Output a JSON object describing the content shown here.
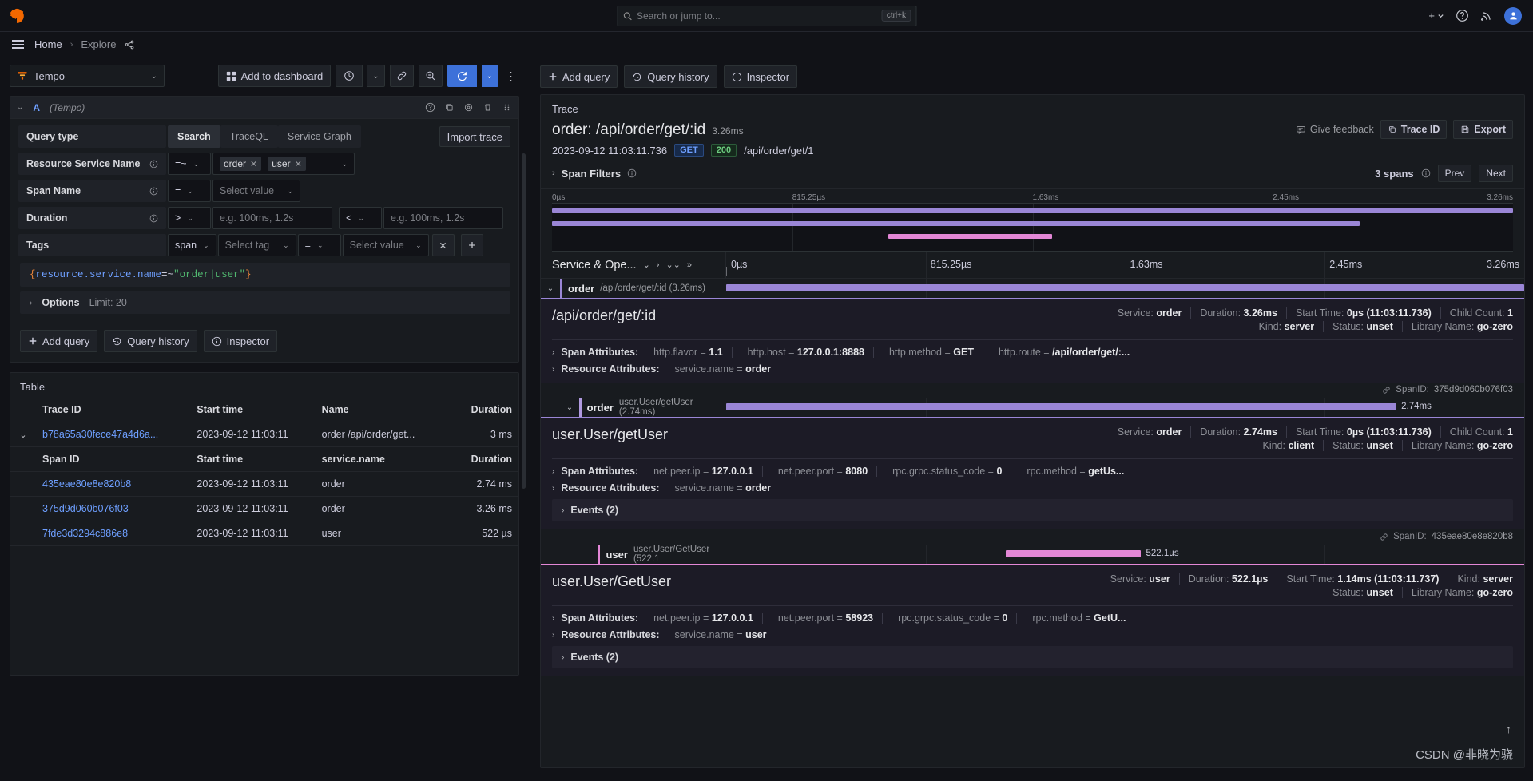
{
  "topbar": {
    "logo_icon": "grafana-logo-icon",
    "search": {
      "placeholder": "Search or jump to...",
      "value": "",
      "shortcut": "ctrl+k",
      "icon": "search-icon"
    },
    "plus_label": "+",
    "help_icon": "help-circle-icon",
    "news_icon": "rss-icon",
    "avatar_icon": "user-avatar-icon"
  },
  "breadcrumb": {
    "menu_icon": "hamburger-menu-icon",
    "home": "Home",
    "separator": "›",
    "current": "Explore",
    "share_icon": "share-icon"
  },
  "toolbar": {
    "datasource": "Tempo",
    "datasource_icon": "tempo-icon",
    "add_to_dashboard": "Add to dashboard",
    "time_picker_icon": "clock-icon",
    "time_chevron": "⌄",
    "link_icon": "link-icon",
    "zoom_out_icon": "zoom-out-icon",
    "refresh_icon": "refresh-icon",
    "refresh_chevron": "⌄",
    "kebab_icon": "more-vertical-icon"
  },
  "query_editor": {
    "collapse_icon": "chevron-down-icon",
    "ref_id": "A",
    "datasource_name": "(Tempo)",
    "actions": [
      "help-circle-icon",
      "copy-icon",
      "eye-icon",
      "trash-icon",
      "drag-handle-icon"
    ],
    "query_type_label": "Query type",
    "query_types": [
      "Search",
      "TraceQL",
      "Service Graph"
    ],
    "active_query_type": "Search",
    "import_trace": "Import trace",
    "fields": [
      {
        "label": "Resource Service Name",
        "info_icon": "info-icon",
        "operator": "=~",
        "values": [
          "order",
          "user"
        ],
        "value_placeholder": ""
      },
      {
        "label": "Span Name",
        "info_icon": "info-icon",
        "operator": "=",
        "value_placeholder": "Select value"
      },
      {
        "label": "Duration",
        "info_icon": "info-icon",
        "operator": ">",
        "min_placeholder": "e.g. 100ms, 1.2s",
        "operator2": "<",
        "max_placeholder": "e.g. 100ms, 1.2s"
      }
    ],
    "tags": {
      "label": "Tags",
      "scope": "span",
      "tag_placeholder": "Select tag",
      "operator": "=",
      "value_placeholder": "Select value",
      "clear_icon": "close-icon",
      "add_icon": "plus-icon"
    },
    "traceql": {
      "open_brace": "{",
      "key": "resource.service.name",
      "operator": "=~",
      "quote_open": "\"",
      "value_a": "order",
      "pipe": "|",
      "value_b": "user",
      "quote_close": "\"",
      "close_brace": "}"
    },
    "options": {
      "chevron": "›",
      "label": "Options",
      "limit": "Limit: 20"
    },
    "buttons": [
      {
        "label": "Add query",
        "icon": "plus-icon"
      },
      {
        "label": "Query history",
        "icon": "history-icon"
      },
      {
        "label": "Inspector",
        "icon": "info-icon"
      }
    ]
  },
  "results_table": {
    "title": "Table",
    "columns": [
      "Trace ID",
      "Start time",
      "Name",
      "Duration"
    ],
    "rows": [
      {
        "expander": "⌄",
        "trace_id": "b78a65a30fece47a4d6a...",
        "start_time": "2023-09-12 11:03:11",
        "name": "order /api/order/get...",
        "duration": "3 ms"
      }
    ],
    "sub_columns": [
      "Span ID",
      "Start time",
      "service.name",
      "Duration"
    ],
    "sub_rows": [
      {
        "span_id": "435eae80e8e820b8",
        "start_time": "2023-09-12 11:03:11",
        "service_name": "order",
        "duration": "2.74 ms"
      },
      {
        "span_id": "375d9d060b076f03",
        "start_time": "2023-09-12 11:03:11",
        "service_name": "order",
        "duration": "3.26 ms"
      },
      {
        "span_id": "7fde3d3294c886e8",
        "start_time": "2023-09-12 11:03:11",
        "service_name": "user",
        "duration": "522 µs"
      }
    ]
  },
  "right_toolbar": {
    "buttons": [
      {
        "label": "Add query",
        "icon": "plus-icon"
      },
      {
        "label": "Query history",
        "icon": "history-icon"
      },
      {
        "label": "Inspector",
        "icon": "info-icon"
      }
    ]
  },
  "trace": {
    "panel_label": "Trace",
    "title": "order: /api/order/get/:id",
    "duration": "3.26ms",
    "timestamp": "2023-09-12 11:03:11.736",
    "method": "GET",
    "status_code": "200",
    "route": "/api/order/get/1",
    "give_feedback": "Give feedback",
    "give_feedback_icon": "feedback-icon",
    "trace_id_button": "Trace ID",
    "trace_id_icon": "copy-icon",
    "export_button": "Export",
    "export_icon": "save-icon",
    "span_filters": {
      "chevron": "›",
      "label": "Span Filters",
      "info_icon": "info-icon",
      "count": "3 spans",
      "count_info_icon": "info-icon",
      "prev": "Prev",
      "next": "Next"
    },
    "minimap_ticks": [
      "0µs",
      "815.25µs",
      "1.63ms",
      "2.45ms",
      "3.26ms"
    ],
    "timeline_header": {
      "column_label": "Service & Ope...",
      "column_chevron": "⌄",
      "expand_one_icon": "chevron-right-icon",
      "expand_all_icon": "chevrons-down-icon",
      "collapse_all_icon": "chevrons-right-icon",
      "ticks": [
        "0µs",
        "815.25µs",
        "1.63ms",
        "2.45ms",
        "3.26ms"
      ]
    },
    "spans": [
      {
        "service": "order",
        "operation": "/api/order/get/:id (3.26ms)",
        "bar_start_pct": 0,
        "bar_width_pct": 100,
        "bar_color": "#9a86d6",
        "bar_label": "",
        "depth": 0,
        "expander": "⌄",
        "detail": {
          "op_name": "/api/order/get/:id",
          "meta_line1": [
            {
              "k": "Service:",
              "v": "order"
            },
            {
              "k": "Duration:",
              "v": "3.26ms"
            },
            {
              "k": "Start Time:",
              "v": "0µs (11:03:11.736)"
            },
            {
              "k": "Child Count:",
              "v": "1"
            }
          ],
          "meta_line2": [
            {
              "k": "Kind:",
              "v": "server"
            },
            {
              "k": "Status:",
              "v": "unset"
            },
            {
              "k": "Library Name:",
              "v": "go-zero"
            }
          ],
          "span_attributes_label": "Span Attributes:",
          "span_attributes": [
            {
              "k": "http.flavor =",
              "v": "1.1"
            },
            {
              "k": "http.host =",
              "v": "127.0.0.1:8888"
            },
            {
              "k": "http.method =",
              "v": "GET"
            },
            {
              "k": "http.route =",
              "v": "/api/order/get/:..."
            }
          ],
          "resource_attributes_label": "Resource Attributes:",
          "resource_attributes": [
            {
              "k": "service.name =",
              "v": "order"
            }
          ],
          "events": null,
          "span_id_label": "SpanID:",
          "span_id": "375d9d060b076f03"
        }
      },
      {
        "service": "order",
        "operation": "user.User/getUser (2.74ms)",
        "bar_start_pct": 0,
        "bar_width_pct": 84,
        "bar_color": "#9a86d6",
        "bar_label": "2.74ms",
        "depth": 1,
        "expander": "⌄",
        "detail": {
          "op_name": "user.User/getUser",
          "meta_line1": [
            {
              "k": "Service:",
              "v": "order"
            },
            {
              "k": "Duration:",
              "v": "2.74ms"
            },
            {
              "k": "Start Time:",
              "v": "0µs (11:03:11.736)"
            },
            {
              "k": "Child Count:",
              "v": "1"
            }
          ],
          "meta_line2": [
            {
              "k": "Kind:",
              "v": "client"
            },
            {
              "k": "Status:",
              "v": "unset"
            },
            {
              "k": "Library Name:",
              "v": "go-zero"
            }
          ],
          "span_attributes_label": "Span Attributes:",
          "span_attributes": [
            {
              "k": "net.peer.ip =",
              "v": "127.0.0.1"
            },
            {
              "k": "net.peer.port =",
              "v": "8080"
            },
            {
              "k": "rpc.grpc.status_code =",
              "v": "0"
            },
            {
              "k": "rpc.method =",
              "v": "getUs..."
            }
          ],
          "resource_attributes_label": "Resource Attributes:",
          "resource_attributes": [
            {
              "k": "service.name =",
              "v": "order"
            }
          ],
          "events": "Events (2)",
          "span_id_label": "SpanID:",
          "span_id": "435eae80e8e820b8"
        }
      },
      {
        "service": "user",
        "operation": "user.User/GetUser (522.1",
        "bar_start_pct": 35,
        "bar_width_pct": 17,
        "bar_color": "#e387d6",
        "bar_label": "522.1µs",
        "depth": 2,
        "expander": "",
        "detail": {
          "op_name": "user.User/GetUser",
          "meta_line1": [
            {
              "k": "Service:",
              "v": "user"
            },
            {
              "k": "Duration:",
              "v": "522.1µs"
            },
            {
              "k": "Start Time:",
              "v": "1.14ms (11:03:11.737)"
            },
            {
              "k": "Kind:",
              "v": "server"
            }
          ],
          "meta_line2": [
            {
              "k": "Status:",
              "v": "unset"
            },
            {
              "k": "Library Name:",
              "v": "go-zero"
            }
          ],
          "span_attributes_label": "Span Attributes:",
          "span_attributes": [
            {
              "k": "net.peer.ip =",
              "v": "127.0.0.1"
            },
            {
              "k": "net.peer.port =",
              "v": "58923"
            },
            {
              "k": "rpc.grpc.status_code =",
              "v": "0"
            },
            {
              "k": "rpc.method =",
              "v": "GetU..."
            }
          ],
          "resource_attributes_label": "Resource Attributes:",
          "resource_attributes": [
            {
              "k": "service.name =",
              "v": "user"
            }
          ],
          "events": "Events (2)",
          "span_id_label": "",
          "span_id": ""
        }
      }
    ],
    "scroll_up_icon": "arrow-up-icon"
  },
  "watermark": "CSDN @非晓为骁",
  "colors": {
    "accent_blue": "#3d71d9",
    "link_blue": "#6e9fff",
    "span_purple": "#9a86d6",
    "span_pink": "#e387d6",
    "panel_bg": "#181b1f",
    "page_bg": "#111217"
  }
}
